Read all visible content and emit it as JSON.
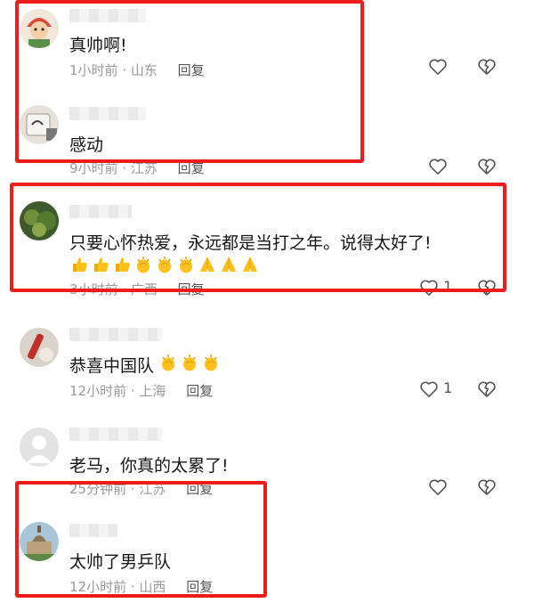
{
  "comments": [
    {
      "text": "真帅啊!",
      "time": "1小时前",
      "location": "山东",
      "reply": "回复",
      "likes": ""
    },
    {
      "text": "感动",
      "time": "9小时前",
      "location": "江苏",
      "reply": "回复",
      "likes": ""
    },
    {
      "text": "只要心怀热爱，永远都是当打之年。说得太好了!",
      "emoji_icons": [
        "thumbs-up-icon",
        "thumbs-up-icon",
        "thumbs-up-icon",
        "clapping-hands-icon",
        "clapping-hands-icon",
        "clapping-hands-icon",
        "folded-hands-icon",
        "folded-hands-icon",
        "folded-hands-icon"
      ],
      "time": "3小时前",
      "location": "广西",
      "reply": "回复",
      "likes": "1"
    },
    {
      "text": "恭喜中国队",
      "emoji_icons": [
        "clapping-hands-icon",
        "clapping-hands-icon",
        "clapping-hands-icon"
      ],
      "time": "12小时前",
      "location": "上海",
      "reply": "回复",
      "likes": "1"
    },
    {
      "text": "老马，你真的太累了!",
      "time": "25分钟前",
      "location": "江苏",
      "reply": "回复",
      "likes": ""
    },
    {
      "text": "太帅了男乒队",
      "time": "12小时前",
      "location": "山西",
      "reply": "回复",
      "likes": ""
    }
  ],
  "icons": {
    "like": "heart-outline-icon",
    "dislike": "broken-heart-icon"
  },
  "colors": {
    "highlight": "#ee1d1d",
    "text": "#161616",
    "meta": "#9a9a9a"
  }
}
